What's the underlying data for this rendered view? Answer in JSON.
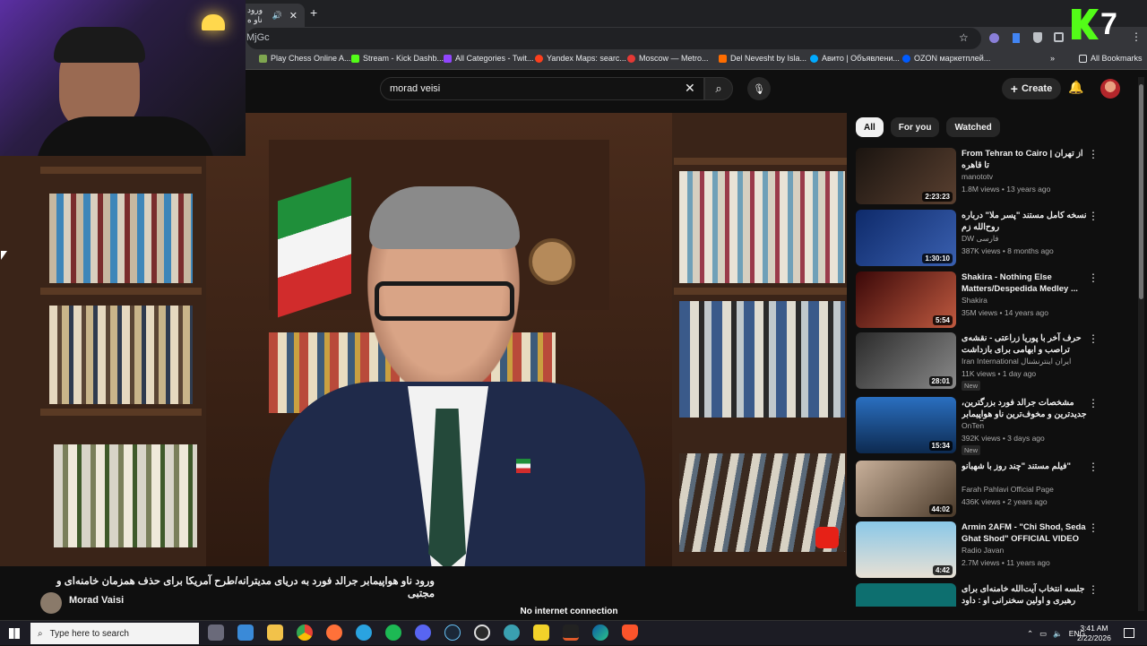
{
  "browser": {
    "tab_title": "ورود ناو ه",
    "url": "MjGc",
    "bookmarks": [
      {
        "label": "Play Chess Online A...",
        "color": "#7fa650"
      },
      {
        "label": "Stream - Kick Dashb...",
        "color": "#53fc18"
      },
      {
        "label": "All Categories - Twit...",
        "color": "#9146ff"
      },
      {
        "label": "Yandex Maps: searc...",
        "color": "#fc3f1d"
      },
      {
        "label": "Moscow — Metro...",
        "color": "#e53935"
      },
      {
        "label": "Del Nevesht by Isla...",
        "color": "#ff6d00"
      },
      {
        "label": "Авито | Объявлени...",
        "color": "#00aaff"
      },
      {
        "label": "OZON маркетплей...",
        "color": "#005bff"
      }
    ],
    "all_bookmarks": "All Bookmarks"
  },
  "header": {
    "search_value": "morad veisi",
    "create_label": "Create"
  },
  "video": {
    "title": "ورود ناو هواپیمابر جرالد فورد به دریای مدیترانه/طرح آمریکا برای حذف همزمان خامنه‌ای و مجتبی",
    "channel": "Morad Vaisi",
    "toast": "No internet connection"
  },
  "filters": [
    "All",
    "For you",
    "Watched"
  ],
  "recommendations": [
    {
      "title": "From Tehran to Cairo | از تهران تا قاهره",
      "channel": "manototv",
      "meta": "1.8M views • 13 years ago",
      "duration": "2:23:23",
      "new": "",
      "thumb": "#2b2420"
    },
    {
      "title": "نسخه کامل مستند \"پسر ملا\" درباره روح‌الله زم",
      "channel": "DW فارسی",
      "meta": "387K views • 8 months ago",
      "duration": "1:30:10",
      "new": "",
      "thumb": "#1b2f5e"
    },
    {
      "title": "Shakira - Nothing Else Matters/Despedida Medley ...",
      "channel": "Shakira",
      "meta": "35M views • 14 years ago",
      "duration": "5:54",
      "new": "",
      "thumb": "#5a1212"
    },
    {
      "title": "حرف آخر با پوریا زراعتی - نقشه‌ی تراصب و ابهامی برای بازداشت خامنه‌ای",
      "channel": "Iran International ایران اینترنشنال",
      "meta": "11K views • 1 day ago",
      "duration": "28:01",
      "new": "New",
      "thumb": "#3a3a3a"
    },
    {
      "title": "مشخصات جرالد فورد بزرگترین، جدیدترین و مخوف‌ترین ناو هواپیمابر آمریکا",
      "channel": "OnTen",
      "meta": "392K views • 3 days ago",
      "duration": "15:34",
      "new": "New",
      "thumb": "#1f4f8a"
    },
    {
      "title": "فیلم مستند \"چند روز با شهبانو\"",
      "channel": "Farah Pahlavi Official Page",
      "meta": "436K views • 2 years ago",
      "duration": "44:02",
      "new": "",
      "thumb": "#6f5a48"
    },
    {
      "title": "Armin 2AFM - \"Chi Shod, Seda Ghat Shod\" OFFICIAL VIDEO",
      "channel": "Radio Javan",
      "meta": "2.7M views • 11 years ago",
      "duration": "4:42",
      "new": "",
      "thumb": "#4a8fb8"
    },
    {
      "title": "جلسه انتخاب آیت‌الله خامنه‌ای برای رهبری و اولین سخنرانی او : داود خون گریست",
      "channel": "",
      "meta": "",
      "duration": "",
      "new": "",
      "thumb": "#0d6f6f"
    }
  ],
  "taskbar": {
    "search_placeholder": "Type here to search",
    "lang": "ENG",
    "time": "3:41 AM",
    "date": "2/22/2026"
  },
  "overlay_logo": "7"
}
